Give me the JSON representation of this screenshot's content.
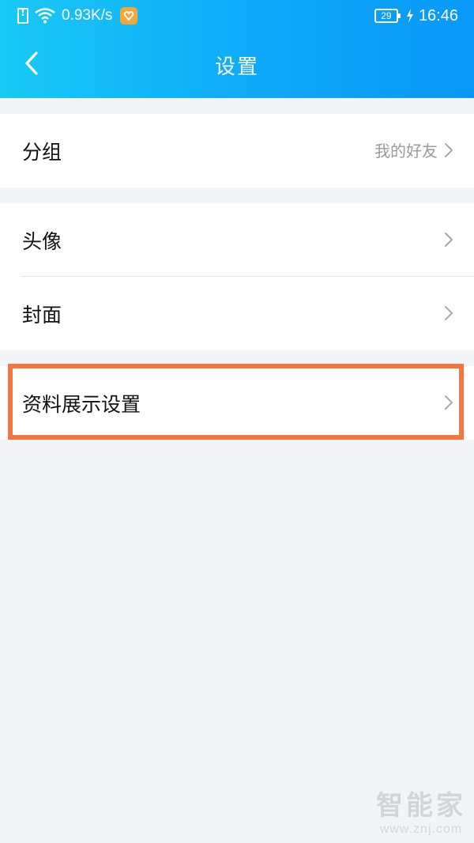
{
  "status_bar": {
    "network_speed": "0.93K/s",
    "battery_level": "29",
    "time": "16:46",
    "icons": [
      "sim-alert-icon",
      "wifi-icon",
      "app-notification-icon",
      "battery-icon",
      "charging-bolt-icon"
    ]
  },
  "navbar": {
    "title": "设置",
    "back_icon": "chevron-left-icon",
    "gradient_colors": [
      "#19c9f6",
      "#0998f8"
    ]
  },
  "settings": {
    "group_friend": {
      "label": "分组",
      "value": "我的好友"
    },
    "group_profile": [
      {
        "label": "头像"
      },
      {
        "label": "封面"
      }
    ],
    "group_display": {
      "label": "资料展示设置",
      "highlight_color": "#f47640"
    }
  },
  "watermark": {
    "text": "智能家",
    "url": "www.znj.com"
  }
}
